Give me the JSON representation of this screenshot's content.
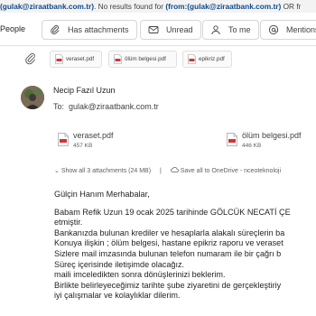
{
  "search_header": {
    "part1": "(gulak@ziraatbank.com.tr)",
    "part2": ". No results found for ",
    "part3": "(from:(gulak@ziraatbank.com.tr)",
    "part4": " OR fr"
  },
  "filters": {
    "people_label": "People",
    "has_attachments": "Has attachments",
    "unread": "Unread",
    "to_me": "To me",
    "mentions": "Mentions"
  },
  "attachment_strip": [
    {
      "name": "veraset.pdf"
    },
    {
      "name": "ölüm belgesi.pdf"
    },
    {
      "name": "epikriz.pdf"
    }
  ],
  "message": {
    "sender": "Necip Fazıl Uzun",
    "to_label": "To:",
    "to_address": "gulak@ziraatbank.com.tr",
    "attachments": [
      {
        "name": "veraset.pdf",
        "size": "457 KB"
      },
      {
        "name": "ölüm belgesi.pdf",
        "size": "446 KB"
      }
    ],
    "show_all": "Show all 3 attachments (24 MB)",
    "save_onedrive": "Save all to OneDrive - nceoteknoloji",
    "body_lines": [
      "Gülçin Hanım Merhabalar,",
      "Babam Refik Uzun 19 ocak 2025 tarihinde GÖLCÜK NECATİ ÇE",
      "etmiştir.",
      "Bankanızda bulunan krediler ve hesaplarla alakalı süreçlerin ba",
      "Konuya ilişkin ; ölüm belgesi, hastane epikriz raporu ve veraset",
      "Sizlere mail imzasında bulunan telefon numaram ile bir çağrı b",
      "Süreç içerisinde iletişimde olacağız.",
      "maili imceledikten sonra dönüşlerinizi beklerim.",
      "Birlikte belirleyeceğimiz tarihte şube ziyaretini de gerçekleştiriy",
      "iyi çalışmalar ve kolaylıklar dilerim."
    ]
  },
  "colors": {
    "accent": "#0f4a8a",
    "pdf_red": "#d13438"
  }
}
